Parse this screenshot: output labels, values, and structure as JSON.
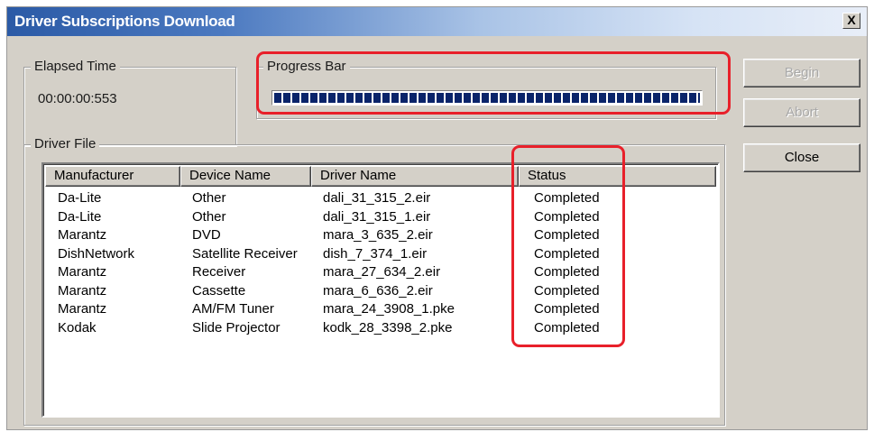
{
  "window": {
    "title": "Driver Subscriptions Download",
    "close_label": "X"
  },
  "elapsed": {
    "label": "Elapsed Time",
    "value": "00:00:00:553"
  },
  "progress": {
    "label": "Progress Bar",
    "fraction": 1.0
  },
  "driver_file": {
    "label": "Driver File",
    "columns": [
      "Manufacturer",
      "Device Name",
      "Driver Name",
      "Status"
    ],
    "rows": [
      [
        "Da-Lite",
        "Other",
        "dali_31_315_2.eir",
        "Completed"
      ],
      [
        "Da-Lite",
        "Other",
        "dali_31_315_1.eir",
        "Completed"
      ],
      [
        "Marantz",
        "DVD",
        "mara_3_635_2.eir",
        "Completed"
      ],
      [
        "DishNetwork",
        "Satellite Receiver",
        "dish_7_374_1.eir",
        "Completed"
      ],
      [
        "Marantz",
        "Receiver",
        "mara_27_634_2.eir",
        "Completed"
      ],
      [
        "Marantz",
        "Cassette",
        "mara_6_636_2.eir",
        "Completed"
      ],
      [
        "Marantz",
        "AM/FM Tuner",
        "mara_24_3908_1.pke",
        "Completed"
      ],
      [
        "Kodak",
        "Slide Projector",
        "kodk_28_3398_2.pke",
        "Completed"
      ]
    ]
  },
  "buttons": {
    "begin": "Begin",
    "abort": "Abort",
    "close": "Close"
  },
  "colors": {
    "highlight": "#e8202a",
    "progress": "#0a246a"
  }
}
